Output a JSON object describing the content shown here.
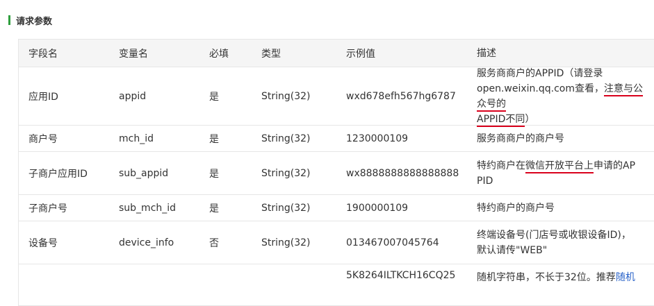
{
  "section": {
    "title": "请求参数"
  },
  "table": {
    "headers": [
      "字段名",
      "变量名",
      "必填",
      "类型",
      "示例值",
      "描述"
    ],
    "rows": [
      {
        "field": "应用ID",
        "name": "appid",
        "required": "是",
        "type": "String(32)",
        "example": "wxd678efh567hg6787",
        "desc_a": "服务商商户的APPID（请登录open.w",
        "desc_b": "eixin.qq.com查看，",
        "desc_b_u": "注意与公众号的",
        "desc_c_u": "APPID不同",
        "desc_c": "）"
      },
      {
        "field": "商户号",
        "name": "mch_id",
        "required": "是",
        "type": "String(32)",
        "example": "1230000109",
        "desc": "服务商商户的商户号"
      },
      {
        "field": "子商户应用ID",
        "name": "sub_appid",
        "required": "是",
        "type": "String(32)",
        "example": "wx8888888888888888",
        "desc_a": "特约商户在",
        "desc_a_u": "微信开放平台上",
        "desc_a2": "申请的AP",
        "desc_b": "PID"
      },
      {
        "field": "子商户号",
        "name": "sub_mch_id",
        "required": "是",
        "type": "String(32)",
        "example": "1900000109",
        "desc": "特约商户的商户号"
      },
      {
        "field": "设备号",
        "name": "device_info",
        "required": "否",
        "type": "String(32)",
        "example": "013467007045764",
        "desc_a": "终端设备号(门店号或收银设备ID)，",
        "desc_b": "默认请传\"WEB\""
      },
      {
        "field": "",
        "name": "",
        "required": "",
        "type": "",
        "example": "5K8264ILTKCH16CQ25",
        "desc_a": "随机字符串，不长于32位。推荐",
        "desc_link": "随机"
      }
    ]
  },
  "colors": {
    "accent_bar": "#2e9e3d",
    "underline": "#d9001b",
    "link": "#2a63c9"
  }
}
